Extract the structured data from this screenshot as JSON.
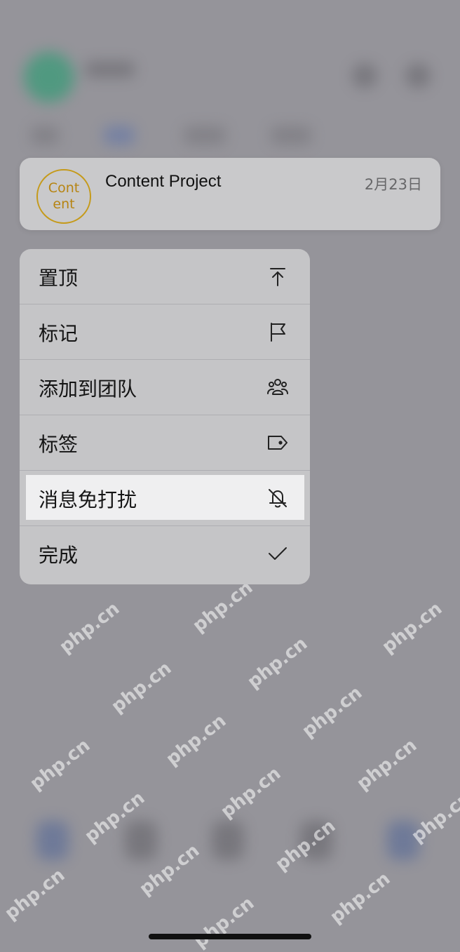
{
  "preview": {
    "avatar_line1": "Cont",
    "avatar_line2": "ent",
    "title": "Content Project",
    "date": "2月23日"
  },
  "menu": {
    "items": [
      {
        "label": "置顶",
        "icon": "pin-to-top-icon"
      },
      {
        "label": "标记",
        "icon": "flag-icon"
      },
      {
        "label": "添加到团队",
        "icon": "team-icon"
      },
      {
        "label": "标签",
        "icon": "tag-icon"
      },
      {
        "label": "消息免打扰",
        "icon": "bell-off-icon",
        "highlighted": true
      },
      {
        "label": "完成",
        "icon": "checkmark-icon"
      }
    ]
  },
  "watermark": "php.cn",
  "colors": {
    "avatar_accent": "#c59a1a",
    "menu_background": "#c5c5c7",
    "highlight": "#efeff0"
  }
}
